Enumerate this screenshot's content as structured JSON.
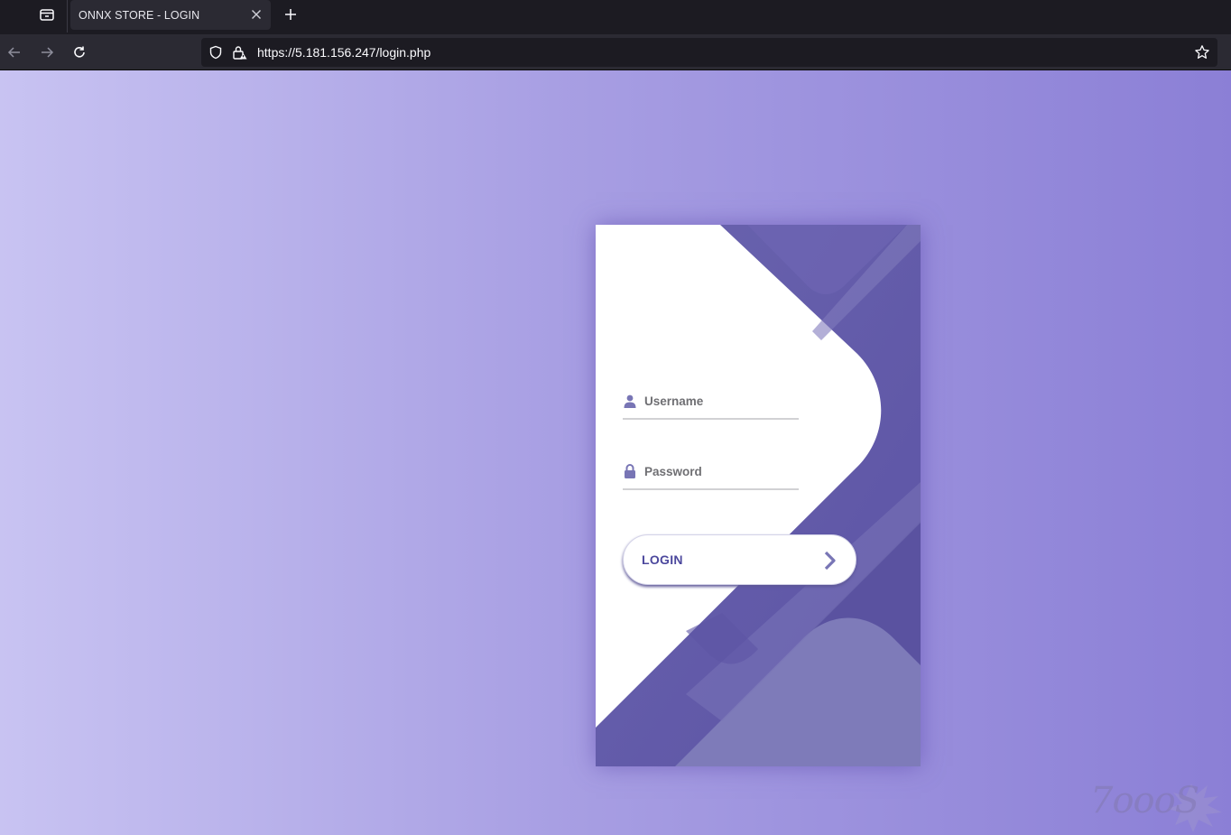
{
  "browser": {
    "tab_title": "ONNX STORE - LOGIN",
    "url": "https://5.181.156.247/login.php",
    "icons": [
      "tab-list-icon",
      "close-icon",
      "plus-icon",
      "back-arrow-icon",
      "forward-arrow-icon",
      "reload-icon",
      "shield-icon",
      "insecure-lock-icon",
      "star-icon"
    ]
  },
  "login_form": {
    "username_placeholder": "Username",
    "password_placeholder": "Password",
    "username_value": "",
    "password_value": "",
    "button_label": "LOGIN"
  },
  "watermark": {
    "text": "7oooS"
  },
  "colors": {
    "accent": "#4c489d",
    "shape_primary": "#6a679e",
    "shape_dark": "#5d54a4",
    "shape_light": "#7e7bb9",
    "background_left": "#c8c3f2",
    "background_right": "#8b7fd6"
  }
}
